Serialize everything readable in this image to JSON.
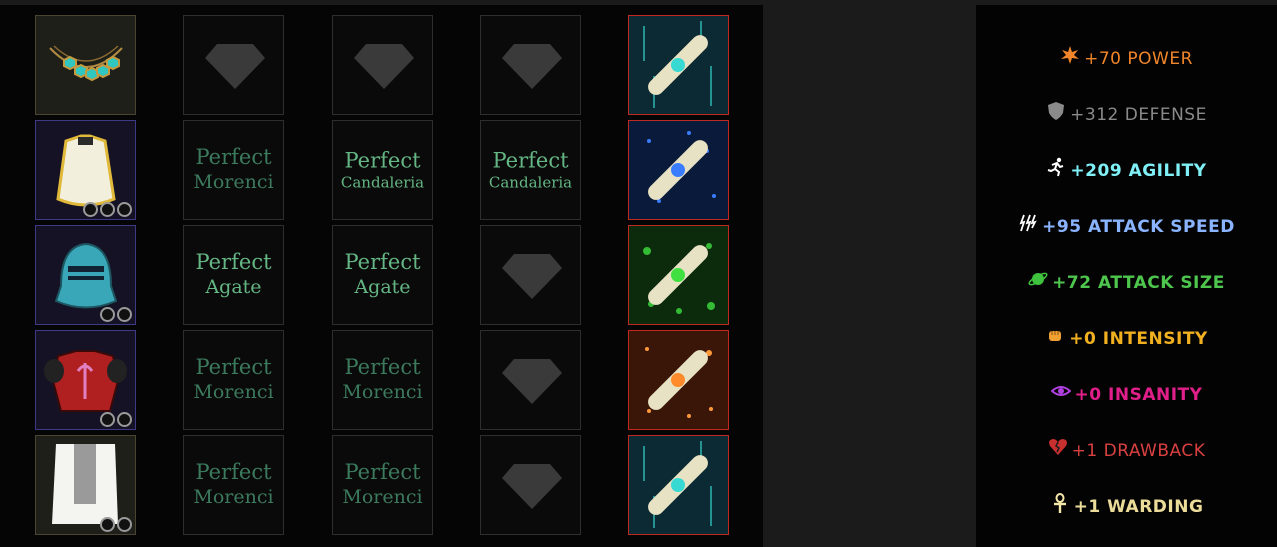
{
  "gems": {
    "perfect": "Perfect",
    "morenci": "Morenci",
    "candaleria": "Candaleria",
    "agate": "Agate"
  },
  "equipment": [
    {
      "slot": "amulet",
      "sockets": 0
    },
    {
      "slot": "chest-robe",
      "sockets": 3
    },
    {
      "slot": "helmet",
      "sockets": 2
    },
    {
      "slot": "armor",
      "sockets": 2
    },
    {
      "slot": "cloak",
      "sockets": 2
    }
  ],
  "scroll_colors": [
    "#37d9d2",
    "#3a7cff",
    "#3fe040",
    "#ff8a2b",
    "#37d9d2"
  ],
  "stats": {
    "power": {
      "text": "+70 POWER",
      "color": "#f0852a",
      "icon": "burst-icon"
    },
    "defense": {
      "text": "+312 DEFENSE",
      "color": "#8a8a8a",
      "icon": "shield-icon"
    },
    "agility": {
      "text": "+209 AGILITY",
      "color": "#7ff0f5",
      "icon": "running-figure-icon"
    },
    "attack_speed": {
      "text": "+95 ATTACK SPEED",
      "color": "#8ab4ff",
      "icon": "claw-slash-icon"
    },
    "attack_size": {
      "text": "+72 ATTACK SIZE",
      "color": "#4ec64e",
      "icon": "planet-icon"
    },
    "intensity": {
      "text": "+0 INTENSITY",
      "color": "#f0b020",
      "icon": "fist-icon"
    },
    "insanity": {
      "text": "+0 INSANITY",
      "color": "#e01f8a",
      "icon": "eye-icon"
    },
    "drawback": {
      "text": "+1 DRAWBACK",
      "color": "#d94040",
      "icon": "broken-heart-icon"
    },
    "warding": {
      "text": "+1 WARDING",
      "color": "#ecdc9a",
      "icon": "ankh-icon"
    }
  }
}
